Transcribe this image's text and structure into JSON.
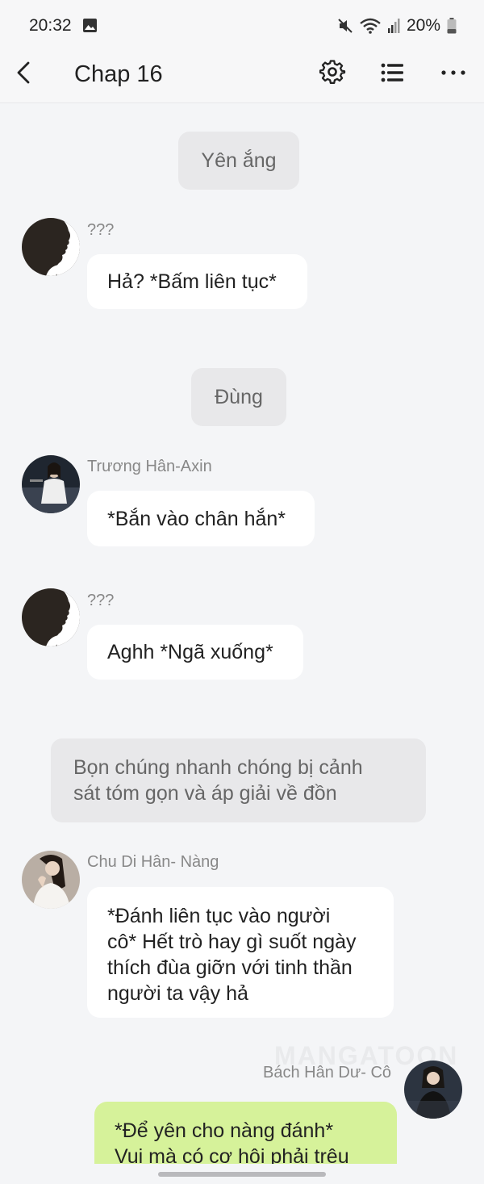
{
  "status_bar": {
    "time": "20:32",
    "battery": "20%",
    "icons": [
      "image-icon",
      "mute-icon",
      "wifi-icon",
      "signal-icon",
      "battery-icon"
    ]
  },
  "nav": {
    "title": "Chap 16",
    "icons": [
      "back-arrow-icon",
      "gear-icon",
      "list-icon",
      "more-icon"
    ]
  },
  "messages": {
    "narration_1": "Yên ắng",
    "m1_name": "???",
    "m1_text": "Hả? *Bấm liên tục*",
    "narration_2": "Đùng",
    "m2_name": "Trương Hân-Axin",
    "m2_text": "*Bắn vào chân hắn*",
    "m3_name": "???",
    "m3_text": "Aghh *Ngã xuống*",
    "narration_3_line1": "Bọn chúng nhanh chóng bị cảnh",
    "narration_3_line2": "sát tóm gọn và áp giải về đồn",
    "m4_name": "Chu Di Hân- Nàng",
    "m4_line1": "*Đánh liên tục vào người",
    "m4_line2": "cô* Hết trò hay gì suốt ngày",
    "m4_line3": "thích đùa giỡn với tinh thần",
    "m4_line4": "người ta vậy hả",
    "m5_name": "Bách Hân Dư- Cô",
    "m5_line1": "*Để yên cho nàng đánh*",
    "m5_line2": "Vui mà có cơ hội phải trêu"
  },
  "watermark": "MANGATOON",
  "colors": {
    "background": "#f4f5f7",
    "bubble_other": "#ffffff",
    "bubble_self": "#d6f29a",
    "narration": "#e8e8ea"
  }
}
